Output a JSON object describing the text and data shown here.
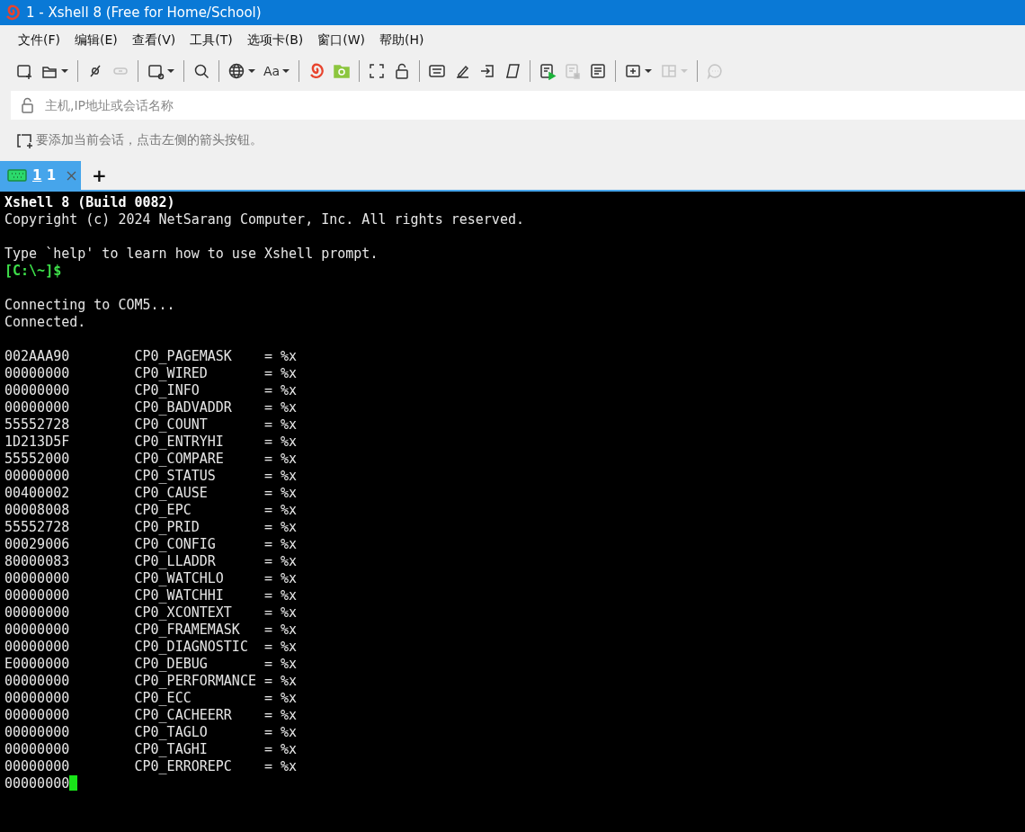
{
  "window": {
    "title": "1 - Xshell 8 (Free for Home/School)"
  },
  "menu": [
    "文件(F)",
    "编辑(E)",
    "查看(V)",
    "工具(T)",
    "选项卡(B)",
    "窗口(W)",
    "帮助(H)"
  ],
  "toolbar": [
    {
      "kind": "new-session",
      "disabled": false,
      "dropdown": false
    },
    {
      "kind": "open-folder",
      "disabled": false,
      "dropdown": true
    },
    {
      "kind": "separator"
    },
    {
      "kind": "disconnect",
      "disabled": false,
      "dropdown": false
    },
    {
      "kind": "reconnect",
      "disabled": true,
      "dropdown": false
    },
    {
      "kind": "separator"
    },
    {
      "kind": "new-window",
      "disabled": false,
      "dropdown": true
    },
    {
      "kind": "separator"
    },
    {
      "kind": "search",
      "disabled": false,
      "dropdown": false
    },
    {
      "kind": "separator"
    },
    {
      "kind": "globe",
      "disabled": false,
      "dropdown": true
    },
    {
      "kind": "font",
      "label": "Aa",
      "disabled": false,
      "dropdown": true
    },
    {
      "kind": "separator"
    },
    {
      "kind": "swirl",
      "disabled": false,
      "dropdown": false
    },
    {
      "kind": "green-folder",
      "disabled": false,
      "dropdown": false
    },
    {
      "kind": "separator"
    },
    {
      "kind": "fullscreen",
      "disabled": false,
      "dropdown": false
    },
    {
      "kind": "lock",
      "disabled": false,
      "dropdown": false
    },
    {
      "kind": "separator"
    },
    {
      "kind": "keyboard",
      "disabled": false,
      "dropdown": false
    },
    {
      "kind": "pen",
      "disabled": false,
      "dropdown": false
    },
    {
      "kind": "arrow-in",
      "disabled": false,
      "dropdown": false
    },
    {
      "kind": "script",
      "disabled": false,
      "dropdown": false
    },
    {
      "kind": "separator"
    },
    {
      "kind": "log-start",
      "disabled": false,
      "dropdown": false
    },
    {
      "kind": "log-stop",
      "disabled": true,
      "dropdown": false
    },
    {
      "kind": "document",
      "disabled": false,
      "dropdown": false
    },
    {
      "kind": "separator"
    },
    {
      "kind": "add-box",
      "disabled": false,
      "dropdown": true
    },
    {
      "kind": "layout",
      "disabled": true,
      "dropdown": true
    },
    {
      "kind": "separator"
    },
    {
      "kind": "chat",
      "disabled": true,
      "dropdown": false
    }
  ],
  "address_bar": {
    "placeholder": "主机,IP地址或会话名称"
  },
  "hint": "要添加当前会话，点击左侧的箭头按钮。",
  "tabs": [
    {
      "number": "1",
      "label": "1",
      "selected": true
    }
  ],
  "new_tab": "+",
  "terminal": [
    {
      "kind": "bold",
      "text": "Xshell 8 (Build 0082)"
    },
    {
      "kind": "normal",
      "text": "Copyright (c) 2024 NetSarang Computer, Inc. All rights reserved."
    },
    {
      "kind": "blank"
    },
    {
      "kind": "normal",
      "text": "Type `help' to learn how to use Xshell prompt."
    },
    {
      "kind": "prompt",
      "text": "[C:\\~]$"
    },
    {
      "kind": "blank"
    },
    {
      "kind": "normal",
      "text": "Connecting to COM5..."
    },
    {
      "kind": "normal",
      "text": "Connected."
    },
    {
      "kind": "blank"
    },
    {
      "kind": "normal",
      "text": "002AAA90        CP0_PAGEMASK    = %x"
    },
    {
      "kind": "normal",
      "text": "00000000        CP0_WIRED       = %x"
    },
    {
      "kind": "normal",
      "text": "00000000        CP0_INFO        = %x"
    },
    {
      "kind": "normal",
      "text": "00000000        CP0_BADVADDR    = %x"
    },
    {
      "kind": "normal",
      "text": "55552728        CP0_COUNT       = %x"
    },
    {
      "kind": "normal",
      "text": "1D213D5F        CP0_ENTRYHI     = %x"
    },
    {
      "kind": "normal",
      "text": "55552000        CP0_COMPARE     = %x"
    },
    {
      "kind": "normal",
      "text": "00000000        CP0_STATUS      = %x"
    },
    {
      "kind": "normal",
      "text": "00400002        CP0_CAUSE       = %x"
    },
    {
      "kind": "normal",
      "text": "00008008        CP0_EPC         = %x"
    },
    {
      "kind": "normal",
      "text": "55552728        CP0_PRID        = %x"
    },
    {
      "kind": "normal",
      "text": "00029006        CP0_CONFIG      = %x"
    },
    {
      "kind": "normal",
      "text": "80000083        CP0_LLADDR      = %x"
    },
    {
      "kind": "normal",
      "text": "00000000        CP0_WATCHLO     = %x"
    },
    {
      "kind": "normal",
      "text": "00000000        CP0_WATCHHI     = %x"
    },
    {
      "kind": "normal",
      "text": "00000000        CP0_XCONTEXT    = %x"
    },
    {
      "kind": "normal",
      "text": "00000000        CP0_FRAMEMASK   = %x"
    },
    {
      "kind": "normal",
      "text": "00000000        CP0_DIAGNOSTIC  = %x"
    },
    {
      "kind": "normal",
      "text": "E0000000        CP0_DEBUG       = %x"
    },
    {
      "kind": "normal",
      "text": "00000000        CP0_PERFORMANCE = %x"
    },
    {
      "kind": "normal",
      "text": "00000000        CP0_ECC         = %x"
    },
    {
      "kind": "normal",
      "text": "00000000        CP0_CACHEERR    = %x"
    },
    {
      "kind": "normal",
      "text": "00000000        CP0_TAGLO       = %x"
    },
    {
      "kind": "normal",
      "text": "00000000        CP0_TAGHI       = %x"
    },
    {
      "kind": "normal",
      "text": "00000000        CP0_ERROREPC    = %x"
    },
    {
      "kind": "cursor",
      "text": "00000000"
    }
  ]
}
